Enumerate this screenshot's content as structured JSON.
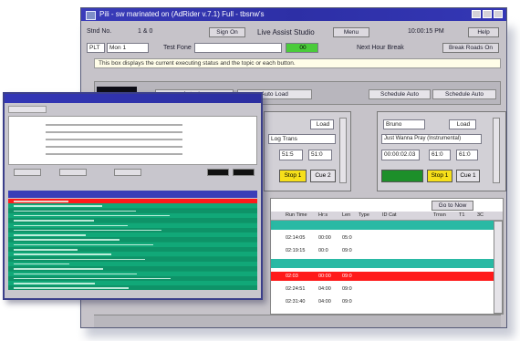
{
  "main_window": {
    "title": "Pili - sw marinated on (AdRider v.7.1) Full - tbsnw's",
    "row1": {
      "station_label": "Stnd No.",
      "station_value": "1 & 0",
      "go_label": "Sign On",
      "studio_label": "Live Assist Studio",
      "menu_label": "Menu",
      "clock_value": "10:00:15 PM",
      "help_label": "Help"
    },
    "row2": {
      "mode_label": "PLT",
      "mode_value": "Mon 1",
      "field_label": "Test Fone",
      "status_value": "00",
      "status_label": "Next Hour Break",
      "right_label": "Break Roads On"
    },
    "message_bar": "This box displays the current executing status and the topic or each button.",
    "toolbar": {
      "autoplay_label": "Autoplay",
      "autoload_label": "Auto Load",
      "btn3_label": "Schedule Auto",
      "btn4_label": "Schedule Auto"
    },
    "deck_left": {
      "load_label": "Load",
      "name_value": "Log Trans",
      "time1": "51:5",
      "time2": "51:0",
      "stop_label": "Stop 1",
      "cue_label": "Cue 2"
    },
    "deck_right": {
      "title_value": "Bruno",
      "load_label": "Load",
      "name_value": "Just Wanna Pray (Instrumental)",
      "time0": "00:00:02.03",
      "time1": "61:0",
      "time2": "61:0",
      "stop_label": "Stop 1",
      "cue_label": "Cue 1"
    },
    "table": {
      "goto_label": "Go to Now",
      "columns": [
        "Run Time",
        "Hr:s",
        "Len",
        "Type",
        "ID Cat",
        "Trnsn",
        "T1",
        "3C"
      ],
      "rows": [
        {
          "time": "",
          "hr": "",
          "len": "",
          "highlight": "teal"
        },
        {
          "time": "02:14:05",
          "hr": "00:00",
          "len": "05:0"
        },
        {
          "time": "02:19:15",
          "hr": "00:0",
          "len": "09:0"
        },
        {
          "time": "",
          "hr": "",
          "len": "",
          "highlight": "teal"
        },
        {
          "time": "02:03",
          "hr": "00:00",
          "len": "09:0",
          "highlight": "red"
        },
        {
          "time": "02:24:51",
          "hr": "04:00",
          "len": "09:0"
        },
        {
          "time": "02:31:40",
          "hr": "04:00",
          "len": "09:0"
        }
      ]
    }
  },
  "colors": {
    "title_bar": "#2d2fa6",
    "highlight_red": "#ff1a1a",
    "grid_green": "#0f9a6c",
    "stop_yellow": "#f6df1a",
    "load_green": "#1d8f2a"
  }
}
